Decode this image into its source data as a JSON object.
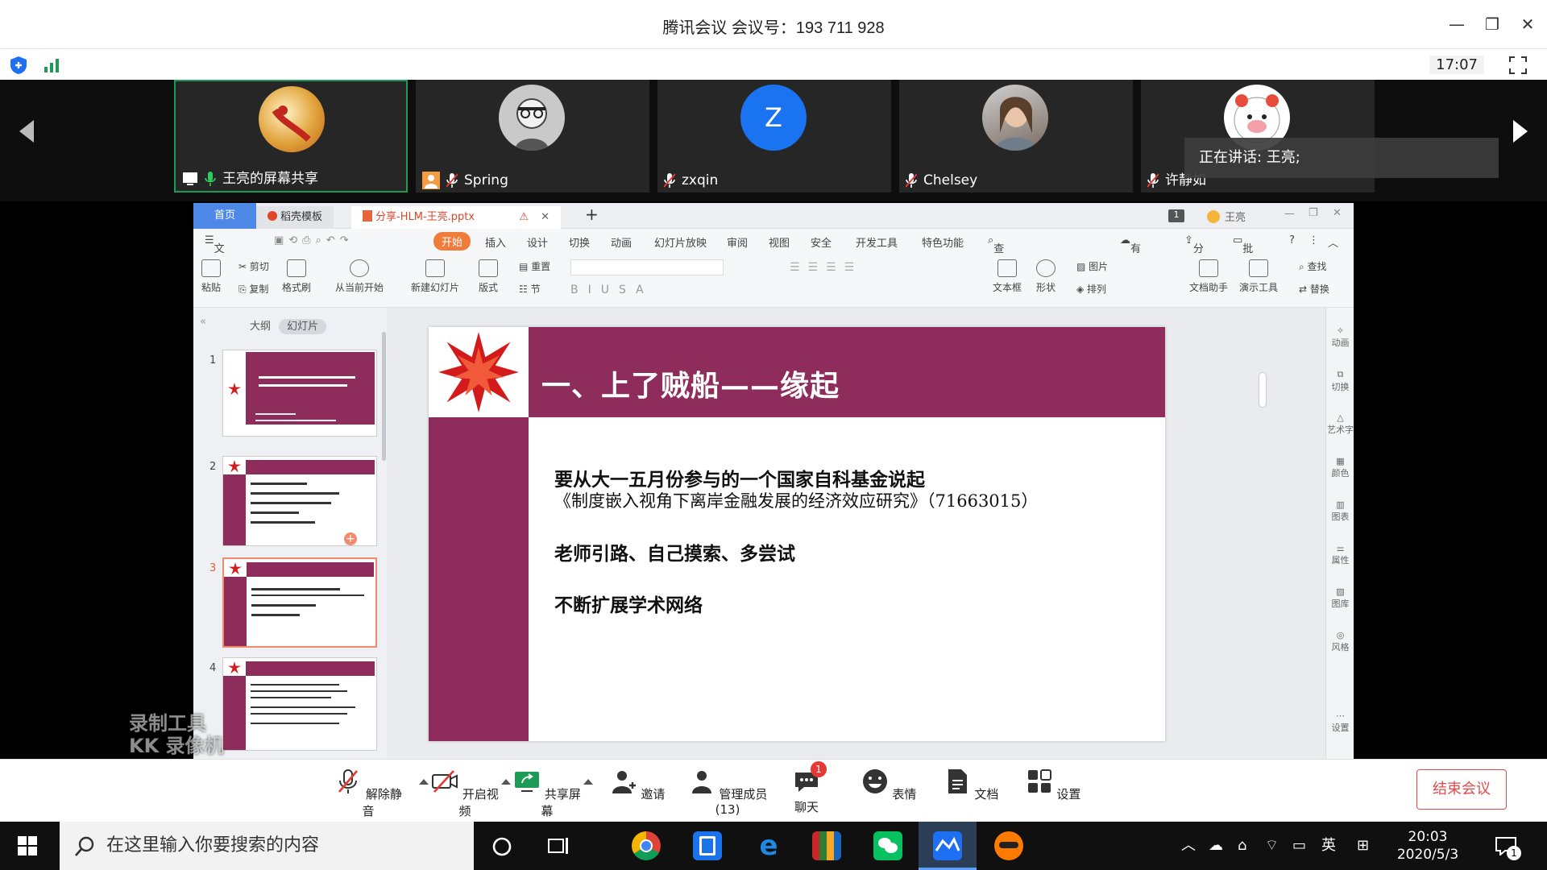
{
  "window": {
    "title": "腾讯会议 会议号：193 711 928",
    "time": "17:07"
  },
  "participants": [
    {
      "name": "王亮的屏幕共享"
    },
    {
      "name": "Spring"
    },
    {
      "name": "zxqin",
      "initial": "Z"
    },
    {
      "name": "Chelsey"
    },
    {
      "name": "许静如"
    }
  ],
  "speaking": "正在讲话: 王亮;",
  "wps": {
    "tabs": [
      "首页",
      "稻壳模板",
      "分享-HLM-王亮.pptx"
    ],
    "user": "王亮",
    "menu": [
      "文件",
      "开始",
      "插入",
      "设计",
      "切换",
      "动画",
      "幻灯片放映",
      "审阅",
      "视图",
      "安全",
      "开发工具",
      "特色功能",
      "查找",
      "有异常",
      "分享",
      "批注"
    ],
    "ribbon": [
      "粘贴",
      "剪切",
      "复制",
      "格式刷",
      "从当前开始",
      "新建幻灯片",
      "版式",
      "重置",
      "节",
      "文本框",
      "形状",
      "图片",
      "排列",
      "文档助手",
      "演示工具",
      "查找",
      "替换"
    ],
    "pane_tabs": [
      "大纲",
      "幻灯片"
    ],
    "thumb_numbers": [
      "1",
      "2",
      "3",
      "4"
    ],
    "right_tools": [
      "动画",
      "切换",
      "艺术字",
      "颜色",
      "图表",
      "属性",
      "图库",
      "风格",
      "设置"
    ]
  },
  "slide": {
    "title": "一、上了贼船——缘起",
    "line1": "要从大一五月份参与的一个国家自科基金说起",
    "line2": "《制度嵌入视角下离岸金融发展的经济效应研究》（71663015）",
    "line3": "老师引路、自己摸索、多尝试",
    "line4": "不断扩展学术网络"
  },
  "watermark": [
    "录制工具",
    "KK 录像机"
  ],
  "controls": [
    "解除静音",
    "开启视频",
    "共享屏幕",
    "邀请",
    "管理成员(13)",
    "聊天",
    "表情",
    "文档",
    "设置"
  ],
  "chat_badge": "1",
  "end_button": "结束会议",
  "taskbar": {
    "search_placeholder": "在这里输入你要搜索的内容",
    "ime": "英",
    "time": "20:03",
    "date": "2020/5/3",
    "notif_count": "1"
  },
  "colors": {
    "slide_accent": "#8e2d5c",
    "meeting_green": "#1d9a55",
    "end_red": "#e24b4b"
  }
}
